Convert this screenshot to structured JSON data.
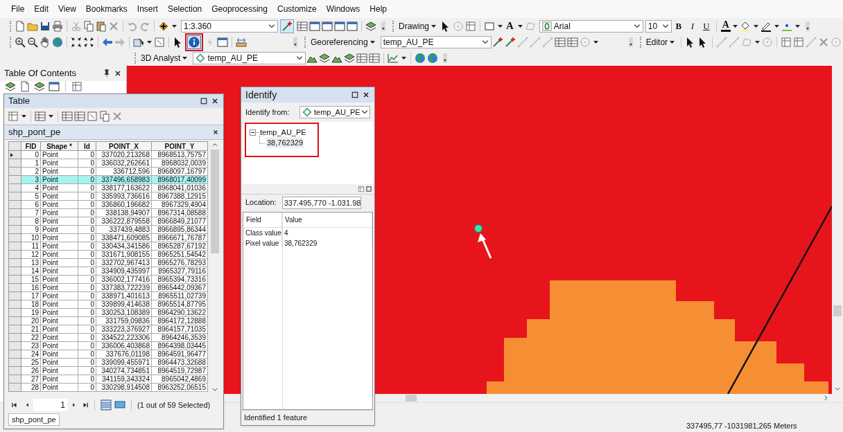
{
  "menu_bar": [
    "File",
    "Edit",
    "View",
    "Bookmarks",
    "Insert",
    "Selection",
    "Geoprocessing",
    "Customize",
    "Windows",
    "Help"
  ],
  "toolbars": {
    "scale": "1:3.360",
    "drawing_menu": "Drawing",
    "text_tool": "A",
    "font": "Arial",
    "font_size": "10",
    "format_buttons": [
      "B",
      "I",
      "U"
    ],
    "font_color": "A",
    "georeferencing_menu": "Georeferencing",
    "georeferencing_layer": "temp_AU_PE",
    "editor_menu": "Editor",
    "analyst_menu": "3D Analyst",
    "analyst_layer": "temp_AU_PE",
    "identify_tool": {
      "selected": true
    }
  },
  "table_of_contents": {
    "title": "Table Of Contents"
  },
  "table_window": {
    "title": "Table",
    "layer_tab": "shp_pont_pe",
    "columns": [
      "FID",
      "Shape *",
      "Id",
      "POINT_X",
      "POINT_Y"
    ],
    "rows": [
      {
        "cells": [
          "0",
          "Point",
          "0",
          "337020,213268",
          "8968513,75757"
        ],
        "selected": false,
        "current": true
      },
      {
        "cells": [
          "1",
          "Point",
          "0",
          "336032,262661",
          "8968032,0039"
        ],
        "selected": false,
        "current": false
      },
      {
        "cells": [
          "2",
          "Point",
          "0",
          "336712,596",
          "8968097,16797"
        ],
        "selected": false,
        "current": false
      },
      {
        "cells": [
          "3",
          "Point",
          "0",
          "337496,658983",
          "8968017,40099"
        ],
        "selected": true,
        "current": false
      },
      {
        "cells": [
          "4",
          "Point",
          "0",
          "338177,163622",
          "8968041,01036"
        ],
        "selected": false,
        "current": false
      },
      {
        "cells": [
          "5",
          "Point",
          "0",
          "335993,736616",
          "8967388,12915"
        ],
        "selected": false,
        "current": false
      },
      {
        "cells": [
          "6",
          "Point",
          "0",
          "336860,196682",
          "8967329,4904"
        ],
        "selected": false,
        "current": false
      },
      {
        "cells": [
          "7",
          "Point",
          "0",
          "338138,94907",
          "8967314,08588"
        ],
        "selected": false,
        "current": false
      },
      {
        "cells": [
          "8",
          "Point",
          "0",
          "336222,879558",
          "8966849,21077"
        ],
        "selected": false,
        "current": false
      },
      {
        "cells": [
          "9",
          "Point",
          "0",
          "337439,4883",
          "8966895,86344"
        ],
        "selected": false,
        "current": false
      },
      {
        "cells": [
          "10",
          "Point",
          "0",
          "338471,609085",
          "8966671,76787"
        ],
        "selected": false,
        "current": false
      },
      {
        "cells": [
          "11",
          "Point",
          "0",
          "330434,341586",
          "8965287,67192"
        ],
        "selected": false,
        "current": false
      },
      {
        "cells": [
          "12",
          "Point",
          "0",
          "331671,908155",
          "8965251,54542"
        ],
        "selected": false,
        "current": false
      },
      {
        "cells": [
          "13",
          "Point",
          "0",
          "332702,967413",
          "8965276,78293"
        ],
        "selected": false,
        "current": false
      },
      {
        "cells": [
          "14",
          "Point",
          "0",
          "334909,435997",
          "8965327,79116"
        ],
        "selected": false,
        "current": false
      },
      {
        "cells": [
          "15",
          "Point",
          "0",
          "336002,177416",
          "8965394,73316"
        ],
        "selected": false,
        "current": false
      },
      {
        "cells": [
          "16",
          "Point",
          "0",
          "337383,722239",
          "8965442,09367"
        ],
        "selected": false,
        "current": false
      },
      {
        "cells": [
          "17",
          "Point",
          "0",
          "338971,401613",
          "8965511,02739"
        ],
        "selected": false,
        "current": false
      },
      {
        "cells": [
          "18",
          "Point",
          "0",
          "339899,414638",
          "8965514,87795"
        ],
        "selected": false,
        "current": false
      },
      {
        "cells": [
          "19",
          "Point",
          "0",
          "330253,108389",
          "8964290,13622"
        ],
        "selected": false,
        "current": false
      },
      {
        "cells": [
          "20",
          "Point",
          "0",
          "331759,09836",
          "8964172,12888"
        ],
        "selected": false,
        "current": false
      },
      {
        "cells": [
          "21",
          "Point",
          "0",
          "333223,376927",
          "8964157,71035"
        ],
        "selected": false,
        "current": false
      },
      {
        "cells": [
          "22",
          "Point",
          "0",
          "334522,223306",
          "8964246,3539"
        ],
        "selected": false,
        "current": false
      },
      {
        "cells": [
          "23",
          "Point",
          "0",
          "336006,403868",
          "8964398,03445"
        ],
        "selected": false,
        "current": false
      },
      {
        "cells": [
          "24",
          "Point",
          "0",
          "337676,01198",
          "8964591,96477"
        ],
        "selected": false,
        "current": false
      },
      {
        "cells": [
          "25",
          "Point",
          "0",
          "339099,455971",
          "8964473,32688"
        ],
        "selected": false,
        "current": false
      },
      {
        "cells": [
          "26",
          "Point",
          "0",
          "340274,734851",
          "8964519,72987"
        ],
        "selected": false,
        "current": false
      },
      {
        "cells": [
          "27",
          "Point",
          "0",
          "341159,343324",
          "8965042,4869"
        ],
        "selected": false,
        "current": false
      },
      {
        "cells": [
          "28",
          "Point",
          "0",
          "330298,914508",
          "8963252,06515"
        ],
        "selected": false,
        "current": false
      }
    ],
    "record": "1",
    "selection_count": "(1 out of 59 Selected)",
    "bottom_tab": "shp_pont_pe"
  },
  "identify": {
    "title": "Identify",
    "from_label": "Identify from:",
    "from_layer": "temp_AU_PE",
    "tree": [
      {
        "label": "temp_AU_PE",
        "expanded": true,
        "children": [
          {
            "label": "38,762329"
          }
        ]
      }
    ],
    "location_label": "Location:",
    "location": "337.495,770  -1.031.98",
    "columns": [
      "Field",
      "Value"
    ],
    "rows": [
      [
        "Class value",
        "4"
      ],
      [
        "Pixel value",
        "38,762329"
      ]
    ],
    "status": "Identified 1 feature"
  },
  "status_bar": {
    "coordinates": "337495,77  -1031981,265 Meters"
  }
}
